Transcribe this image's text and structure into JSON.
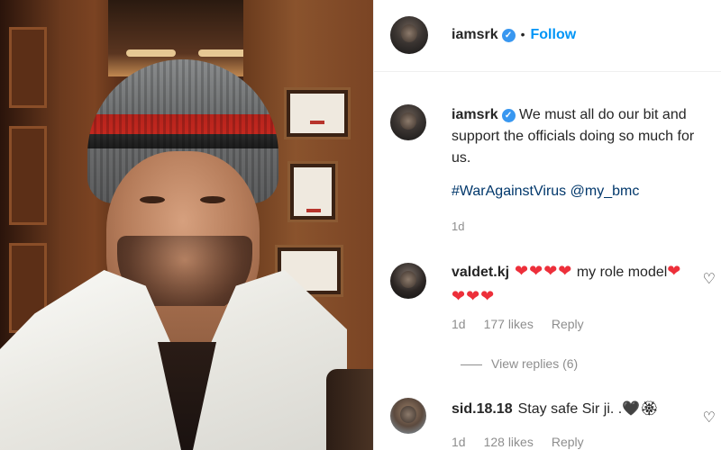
{
  "post": {
    "username": "iamsrk",
    "verified_mark": "✓",
    "separator": "•",
    "follow_label": "Follow",
    "caption": "We must all do our bit and support the officials doing so much for us.",
    "hashtag": "#WarAgainstVirus",
    "mention": "@my_bmc",
    "time": "1d"
  },
  "comments": [
    {
      "username": "valdet.kj",
      "hearts_before": "❤❤❤❤",
      "text": "my role model",
      "hearts_after": "❤❤❤❤",
      "time": "1d",
      "likes": "177 likes",
      "reply": "Reply",
      "like_icon": "heart-outline-icon"
    },
    {
      "username": "sid.18.18",
      "text": "Stay safe Sir ji. .",
      "emoji": "🖤🏵",
      "time": "1d",
      "likes": "128 likes",
      "reply": "Reply",
      "like_icon": "heart-outline-icon"
    }
  ],
  "view_replies": "View replies (6)",
  "colors": {
    "link_blue": "#0095f6",
    "verified_blue": "#3897f0",
    "hashtag_navy": "#00376b",
    "muted_gray": "#8e8e8e",
    "heart_red": "#ed2f3a"
  }
}
